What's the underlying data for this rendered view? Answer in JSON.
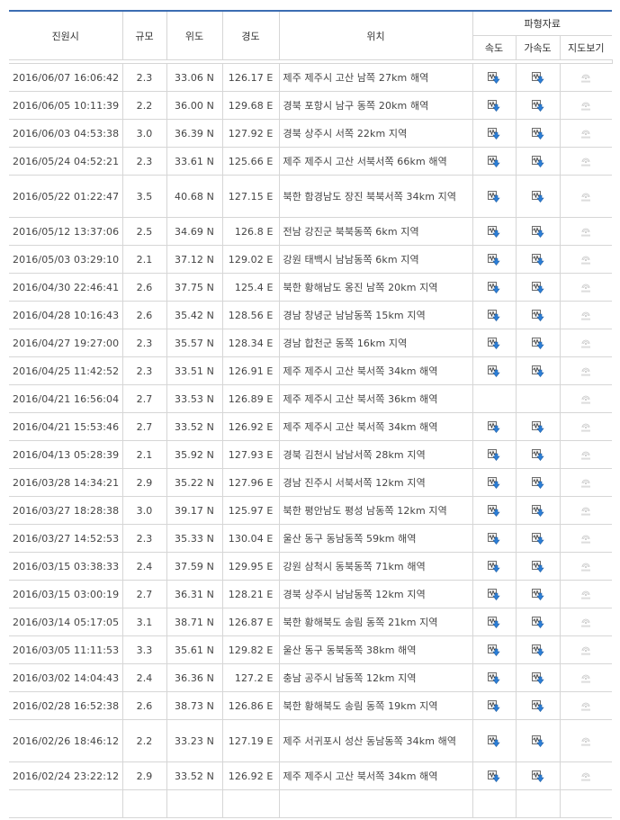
{
  "table": {
    "headers": {
      "time": "진원시",
      "magnitude": "규모",
      "latitude": "위도",
      "longitude": "경도",
      "location": "위치",
      "waveform_group": "파형자료",
      "velocity": "속도",
      "acceleration": "가속도",
      "map_view": "지도보기"
    },
    "icons": {
      "velocity": "waveform-download-icon",
      "acceleration": "waveform-download-icon",
      "map": "map-view-icon"
    },
    "rows": [
      {
        "time": "2016/06/07 16:06:42",
        "mag": "2.3",
        "lat": "33.06 N",
        "lon": "126.17 E",
        "loc": "제주 제주시 고산 남쪽 27km 해역",
        "vel": true,
        "acc": true,
        "tall": false
      },
      {
        "time": "2016/06/05 10:11:39",
        "mag": "2.2",
        "lat": "36.00 N",
        "lon": "129.68 E",
        "loc": "경북 포항시 남구 동쪽 20km 해역",
        "vel": true,
        "acc": true,
        "tall": false
      },
      {
        "time": "2016/06/03 04:53:38",
        "mag": "3.0",
        "lat": "36.39 N",
        "lon": "127.92 E",
        "loc": "경북 상주시 서쪽 22km 지역",
        "vel": true,
        "acc": true,
        "tall": false
      },
      {
        "time": "2016/05/24 04:52:21",
        "mag": "2.3",
        "lat": "33.61 N",
        "lon": "125.66 E",
        "loc": "제주 제주시 고산 서북서쪽 66km 해역",
        "vel": true,
        "acc": true,
        "tall": false
      },
      {
        "time": "2016/05/22 01:22:47",
        "mag": "3.5",
        "lat": "40.68 N",
        "lon": "127.15 E",
        "loc": "북한 함경남도 장진 북북서쪽 34km 지역",
        "vel": true,
        "acc": true,
        "tall": true
      },
      {
        "time": "2016/05/12 13:37:06",
        "mag": "2.5",
        "lat": "34.69 N",
        "lon": "126.8 E",
        "loc": "전남 강진군 북북동쪽 6km 지역",
        "vel": true,
        "acc": true,
        "tall": false
      },
      {
        "time": "2016/05/03 03:29:10",
        "mag": "2.1",
        "lat": "37.12 N",
        "lon": "129.02 E",
        "loc": "강원 태백시 남남동쪽 6km 지역",
        "vel": true,
        "acc": true,
        "tall": false
      },
      {
        "time": "2016/04/30 22:46:41",
        "mag": "2.6",
        "lat": "37.75 N",
        "lon": "125.4 E",
        "loc": "북한 황해남도 옹진 남쪽 20km 지역",
        "vel": true,
        "acc": true,
        "tall": false
      },
      {
        "time": "2016/04/28 10:16:43",
        "mag": "2.6",
        "lat": "35.42 N",
        "lon": "128.56 E",
        "loc": "경남 창녕군 남남동쪽 15km 지역",
        "vel": true,
        "acc": true,
        "tall": false
      },
      {
        "time": "2016/04/27 19:27:00",
        "mag": "2.3",
        "lat": "35.57 N",
        "lon": "128.34 E",
        "loc": "경남 합천군 동쪽 16km 지역",
        "vel": true,
        "acc": true,
        "tall": false
      },
      {
        "time": "2016/04/25 11:42:52",
        "mag": "2.3",
        "lat": "33.51 N",
        "lon": "126.91 E",
        "loc": "제주 제주시 고산 북서쪽 34km 해역",
        "vel": true,
        "acc": true,
        "tall": false
      },
      {
        "time": "2016/04/21 16:56:04",
        "mag": "2.7",
        "lat": "33.53 N",
        "lon": "126.89 E",
        "loc": "제주 제주시 고산 북서쪽 36km 해역",
        "vel": false,
        "acc": false,
        "tall": false
      },
      {
        "time": "2016/04/21 15:53:46",
        "mag": "2.7",
        "lat": "33.52 N",
        "lon": "126.92 E",
        "loc": "제주 제주시 고산 북서쪽 34km 해역",
        "vel": true,
        "acc": true,
        "tall": false
      },
      {
        "time": "2016/04/13 05:28:39",
        "mag": "2.1",
        "lat": "35.92 N",
        "lon": "127.93 E",
        "loc": "경북 김천시 남남서쪽 28km 지역",
        "vel": true,
        "acc": true,
        "tall": false
      },
      {
        "time": "2016/03/28 14:34:21",
        "mag": "2.9",
        "lat": "35.22 N",
        "lon": "127.96 E",
        "loc": "경남 진주시 서북서쪽 12km 지역",
        "vel": true,
        "acc": true,
        "tall": false
      },
      {
        "time": "2016/03/27 18:28:38",
        "mag": "3.0",
        "lat": "39.17 N",
        "lon": "125.97 E",
        "loc": "북한 평안남도 평성 남동쪽 12km 지역",
        "vel": true,
        "acc": true,
        "tall": false
      },
      {
        "time": "2016/03/27 14:52:53",
        "mag": "2.3",
        "lat": "35.33 N",
        "lon": "130.04 E",
        "loc": "울산 동구 동남동쪽 59km 해역",
        "vel": true,
        "acc": true,
        "tall": false
      },
      {
        "time": "2016/03/15 03:38:33",
        "mag": "2.4",
        "lat": "37.59 N",
        "lon": "129.95 E",
        "loc": "강원 삼척시 동북동쪽 71km 해역",
        "vel": true,
        "acc": true,
        "tall": false
      },
      {
        "time": "2016/03/15 03:00:19",
        "mag": "2.7",
        "lat": "36.31 N",
        "lon": "128.21 E",
        "loc": "경북 상주시 남남동쪽 12km 지역",
        "vel": true,
        "acc": true,
        "tall": false
      },
      {
        "time": "2016/03/14 05:17:05",
        "mag": "3.1",
        "lat": "38.71 N",
        "lon": "126.87 E",
        "loc": "북한 황해북도 송림 동쪽 21km 지역",
        "vel": true,
        "acc": true,
        "tall": false
      },
      {
        "time": "2016/03/05 11:11:53",
        "mag": "3.3",
        "lat": "35.61 N",
        "lon": "129.82 E",
        "loc": "울산 동구 동북동쪽 38km 해역",
        "vel": true,
        "acc": true,
        "tall": false
      },
      {
        "time": "2016/03/02 14:04:43",
        "mag": "2.4",
        "lat": "36.36 N",
        "lon": "127.2 E",
        "loc": "충남 공주시 남동쪽 12km 지역",
        "vel": true,
        "acc": true,
        "tall": false
      },
      {
        "time": "2016/02/28 16:52:38",
        "mag": "2.6",
        "lat": "38.73 N",
        "lon": "126.86 E",
        "loc": "북한 황해북도 송림 동쪽 19km 지역",
        "vel": true,
        "acc": true,
        "tall": false
      },
      {
        "time": "2016/02/26 18:46:12",
        "mag": "2.2",
        "lat": "33.23 N",
        "lon": "127.19 E",
        "loc": "제주 서귀포시 성산 동남동쪽 34km 해역",
        "vel": true,
        "acc": true,
        "tall": true
      },
      {
        "time": "2016/02/24 23:22:12",
        "mag": "2.9",
        "lat": "33.52 N",
        "lon": "126.92 E",
        "loc": "제주 제주시 고산 북서쪽 34km 해역",
        "vel": true,
        "acc": true,
        "tall": false
      },
      {
        "time": "",
        "mag": "",
        "lat": "",
        "lon": "",
        "loc": "",
        "vel": false,
        "acc": false,
        "tall": false
      }
    ]
  }
}
